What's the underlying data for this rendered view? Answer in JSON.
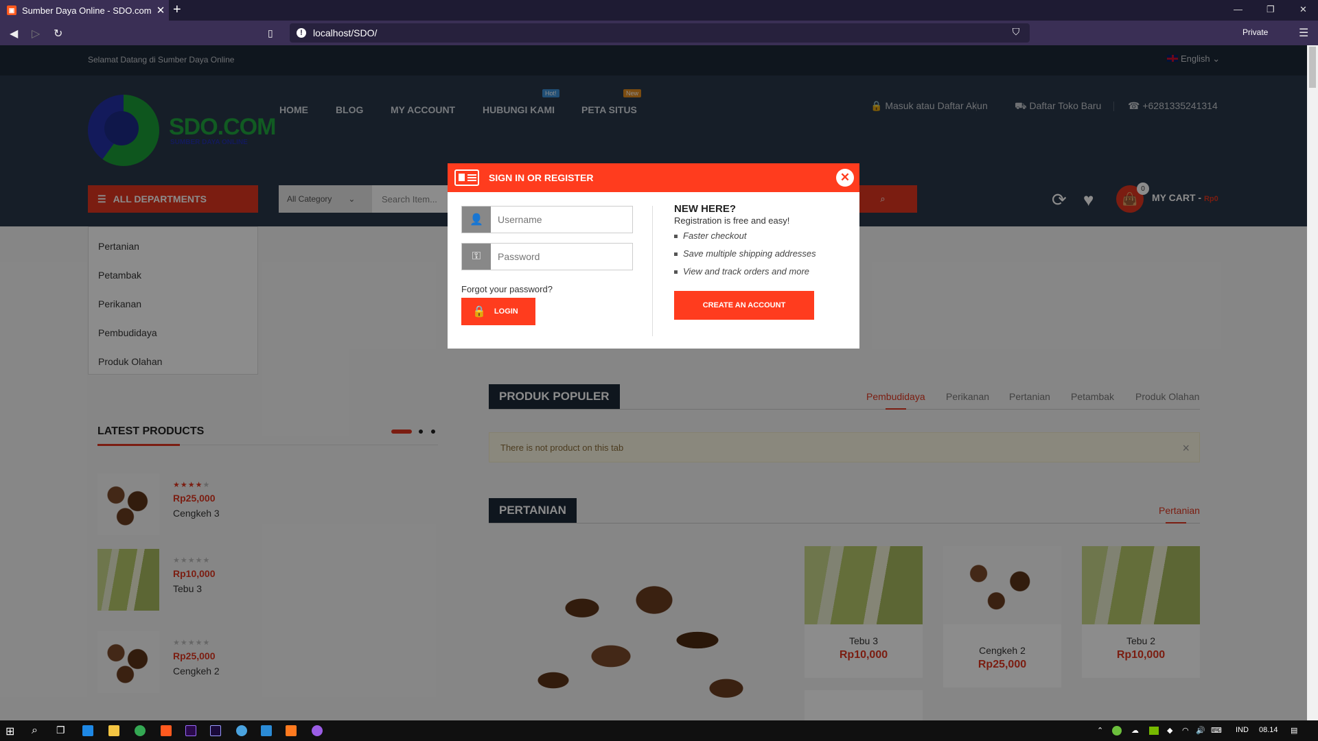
{
  "browser": {
    "tab_title": "Sumber Daya Online - SDO.com",
    "tab_close": "✕",
    "new_tab": "+",
    "url": "localhost/SDO/",
    "private_label": "Private",
    "minimize": "—",
    "restore": "❐",
    "close": "✕"
  },
  "topbar": {
    "welcome": "Selamat Datang di Sumber Daya Online",
    "language": "English"
  },
  "logo": {
    "text": "SDO.COM",
    "sub": "SUMBER DAYA ONLINE"
  },
  "menu": [
    {
      "label": "HOME"
    },
    {
      "label": "BLOG"
    },
    {
      "label": "MY ACCOUNT"
    },
    {
      "label": "HUBUNGI KAMI",
      "badge": "Hot!"
    },
    {
      "label": "PETA SITUS",
      "badge": "New"
    }
  ],
  "header_links": {
    "login": "Masuk atau Daftar Akun",
    "store": "Daftar Toko Baru",
    "phone": "+6281335241314"
  },
  "departments": {
    "title": "ALL DEPARTMENTS",
    "items": [
      "Pertanian",
      "Petambak",
      "Perikanan",
      "Pembudidaya",
      "Produk Olahan"
    ]
  },
  "search": {
    "category": "All Category",
    "placeholder": "Search Item..."
  },
  "cart": {
    "label": "MY CART -",
    "amount": "Rp0",
    "count": "0"
  },
  "latest": {
    "title": "LATEST PRODUCTS",
    "items": [
      {
        "price": "Rp25,000",
        "name": "Cengkeh 3",
        "rating": 4,
        "image": "clove"
      },
      {
        "price": "Rp10,000",
        "name": "Tebu 3",
        "rating": 0,
        "image": "cane"
      },
      {
        "price": "Rp25,000",
        "name": "Cengkeh 2",
        "rating": 0,
        "image": "clove"
      }
    ]
  },
  "popular": {
    "title": "PRODUK POPULER",
    "tabs": [
      "Pembudidaya",
      "Perikanan",
      "Pertanian",
      "Petambak",
      "Produk Olahan"
    ],
    "active_tab": "Pembudidaya",
    "empty_message": "There is not product on this tab",
    "dismiss": "×"
  },
  "pertanian": {
    "title": "PERTANIAN",
    "tab": "Pertanian",
    "cards": [
      {
        "name": "Tebu 3",
        "price": "Rp10,000",
        "image": "cane"
      },
      {
        "name": "Cengkeh 2",
        "price": "Rp25,000",
        "image": "clove"
      },
      {
        "name": "Tebu 2",
        "price": "Rp10,000",
        "image": "cane"
      }
    ]
  },
  "modal": {
    "title": "SIGN IN OR REGISTER",
    "close": "✕",
    "username_placeholder": "Username",
    "password_placeholder": "Password",
    "forgot": "Forgot your password?",
    "login": "LOGIN",
    "new_here": "NEW HERE?",
    "registration": "Registration is free and easy!",
    "benefits": [
      "Faster checkout",
      "Save multiple shipping addresses",
      "View and track orders and more"
    ],
    "create": "CREATE AN ACCOUNT"
  },
  "taskbar": {
    "lang": "IND",
    "time": "08.14"
  },
  "colors": {
    "accent": "#ff3c1e",
    "header": "#283749",
    "dark": "#1d2938"
  }
}
